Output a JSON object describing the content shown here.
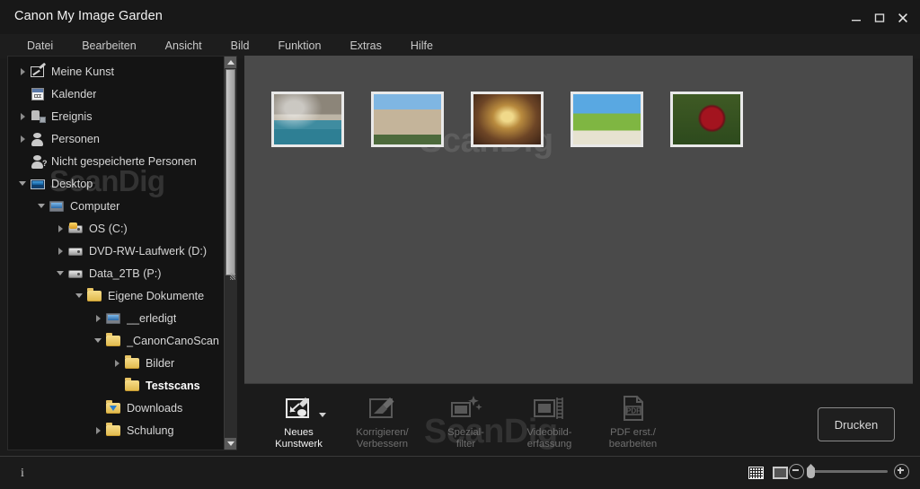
{
  "window": {
    "title": "Canon My Image Garden",
    "controls": [
      {
        "name": "minimize",
        "label": "–"
      },
      {
        "name": "maximize",
        "label": "□"
      },
      {
        "name": "close",
        "label": "✕"
      }
    ]
  },
  "menubar": {
    "items": [
      {
        "label": "Datei"
      },
      {
        "label": "Bearbeiten"
      },
      {
        "label": "Ansicht"
      },
      {
        "label": "Bild"
      },
      {
        "label": "Funktion"
      },
      {
        "label": "Extras"
      },
      {
        "label": "Hilfe"
      }
    ]
  },
  "watermark": {
    "text": "ScanDig"
  },
  "sidebar": {
    "tree": [
      {
        "label": "Meine Kunst",
        "indent": 0,
        "twisty": "right",
        "icon": "artwork-icon",
        "selected": false
      },
      {
        "label": "Kalender",
        "indent": 0,
        "twisty": "none",
        "icon": "calendar-icon",
        "selected": false
      },
      {
        "label": "Ereignis",
        "indent": 0,
        "twisty": "right",
        "icon": "event-icon",
        "selected": false
      },
      {
        "label": "Personen",
        "indent": 0,
        "twisty": "right",
        "icon": "person-icon",
        "selected": false
      },
      {
        "label": "Nicht gespeicherte Personen",
        "indent": 0,
        "twisty": "none",
        "icon": "person-unknown-icon",
        "selected": false
      },
      {
        "label": "Desktop",
        "indent": 0,
        "twisty": "down",
        "icon": "desktop-icon",
        "selected": false
      },
      {
        "label": "Computer",
        "indent": 1,
        "twisty": "down",
        "icon": "computer-icon",
        "selected": false
      },
      {
        "label": "OS (C:)",
        "indent": 2,
        "twisty": "right",
        "icon": "drive-os-icon",
        "selected": false
      },
      {
        "label": "DVD-RW-Laufwerk (D:)",
        "indent": 2,
        "twisty": "right",
        "icon": "dvd-drive-icon",
        "selected": false
      },
      {
        "label": "Data_2TB (P:)",
        "indent": 2,
        "twisty": "down",
        "icon": "hdd-icon",
        "selected": false
      },
      {
        "label": "Eigene Dokumente",
        "indent": 3,
        "twisty": "down",
        "icon": "folder-icon",
        "selected": false
      },
      {
        "label": "__erledigt",
        "indent": 4,
        "twisty": "right",
        "icon": "shared-folder-icon",
        "selected": false
      },
      {
        "label": "_CanonCanoScan",
        "indent": 4,
        "twisty": "down",
        "icon": "folder-icon",
        "selected": false
      },
      {
        "label": "Bilder",
        "indent": 5,
        "twisty": "right",
        "icon": "folder-icon",
        "selected": false
      },
      {
        "label": "Testscans",
        "indent": 5,
        "twisty": "none",
        "icon": "folder-icon",
        "selected": true
      },
      {
        "label": "Downloads",
        "indent": 4,
        "twisty": "none",
        "icon": "downloads-folder-icon",
        "selected": false
      },
      {
        "label": "Schulung",
        "indent": 4,
        "twisty": "right",
        "icon": "folder-icon",
        "selected": false
      }
    ],
    "scroll": {
      "vertical_up_icon": "scroll-up-arrow-icon",
      "vertical_down_icon": "scroll-down-arrow-icon",
      "horizontal_left_icon": "scroll-left-arrow-icon",
      "horizontal_right_icon": "scroll-right-arrow-icon"
    }
  },
  "main": {
    "thumbnails": [
      {
        "name": "harbour-bay-photo",
        "alt": "Harbour bay with boats and rocky hillside"
      },
      {
        "name": "museum-building-photo",
        "alt": "Historic museum building with blue sky"
      },
      {
        "name": "palace-interior-photo",
        "alt": "Ornate golden palace interior hall"
      },
      {
        "name": "dune-landscape-photo",
        "alt": "Green dune landscape with white sand"
      },
      {
        "name": "red-dahlia-photo",
        "alt": "Red dahlia flower close-up"
      }
    ]
  },
  "functionbar": {
    "buttons": [
      {
        "label_line1": "Neues",
        "label_line2": "Kunstwerk",
        "icon": "new-artwork-icon",
        "active": true,
        "has_dropdown": true
      },
      {
        "label_line1": "Korrigieren/",
        "label_line2": "Verbessern",
        "icon": "correct-enhance-icon",
        "active": false,
        "has_dropdown": false
      },
      {
        "label_line1": "Spezial-",
        "label_line2": "filter",
        "icon": "special-filter-icon",
        "active": false,
        "has_dropdown": false
      },
      {
        "label_line1": "Videobild-",
        "label_line2": "erfassung",
        "icon": "video-frame-capture-icon",
        "active": false,
        "has_dropdown": false
      },
      {
        "label_line1": "PDF erst./",
        "label_line2": "bearbeiten",
        "icon": "pdf-create-edit-icon",
        "active": false,
        "has_dropdown": false
      }
    ],
    "print_button": "Drucken"
  },
  "statusbar": {
    "info_icon": "info-icon",
    "info_glyph": "i",
    "view_grid_icon": "thumbnail-grid-view-icon",
    "view_single_icon": "single-image-view-icon",
    "zoom_out_icon": "zoom-out-icon",
    "zoom_in_icon": "zoom-in-icon",
    "zoom_slider": "zoom-slider"
  },
  "colors": {
    "window_bg": "#1b1b1b",
    "titlebar_bg": "#181818",
    "content_bg": "#4a4a4a",
    "sidebar_bg": "#141414",
    "text": "#d6d6d6",
    "text_dim": "#6f6f6f",
    "accent_selected": "#ffffff"
  }
}
